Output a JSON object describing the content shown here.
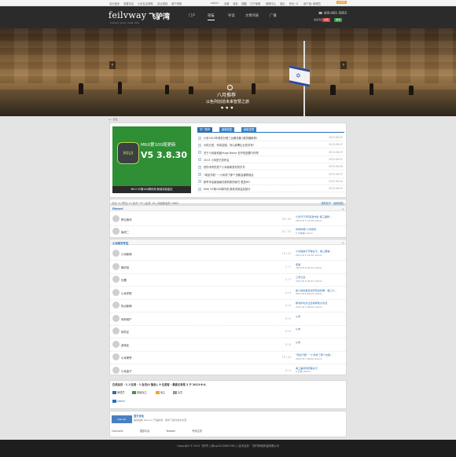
{
  "topbar": {
    "left": [
      "设为首页",
      "收藏本站",
      "小米社区帮助",
      "论坛规则",
      "用户帮助"
    ],
    "right": [
      "admin",
      "设置",
      "消息",
      "提醒",
      "门户管理",
      "管理中心",
      "退出",
      "积分: 0",
      "用户组: 管理员"
    ],
    "badge": "LOGO"
  },
  "header": {
    "logo_en": "feilvway",
    "logo_zh": "飞驴湾",
    "slogan": "travel your new life",
    "nav": [
      "门户",
      "论坛",
      "导读",
      "文章列表",
      "广播"
    ],
    "active": "论坛",
    "phone": "400-801-5855",
    "welcome": "发送消息",
    "btn1": "充值",
    "btn2": "发布"
  },
  "hero": {
    "title": "八月推荐",
    "subtitle": "以色列创造未来智慧之旅",
    "prev": "‹",
    "next": "›",
    "dots": "● ● ●"
  },
  "breadcrumb": "⌂ › 论坛",
  "featured": {
    "slide_title": "MIUI第100周更新",
    "slide_version": "V5 3.8.30",
    "slide_logo": "MIUI",
    "caption": "MIUI V5第100周内测 新增流量监控",
    "tabs": [
      "热门推荐",
      "最新回复",
      "最新发表"
    ],
    "news": [
      {
        "title": "小米2013年第四分第三台服务器 (服务器维修)",
        "date": "2013-08-02"
      },
      {
        "title": "大陆已进，你真遗憾。何以部署企业的关系？",
        "date": "2013-08-07"
      },
      {
        "title": "关于小米最低级Huge Bama 但不知道要行何赞",
        "date": "2013-08-07"
      },
      {
        "title": "2013 小米是已发布会",
        "date": "2013-08-01"
      },
      {
        "title": "前所未有的是个小米最新发布的东东",
        "date": "2013-08-06"
      },
      {
        "title": "\"增加不能\" 一小米成了那个也都会通得到此",
        "date": "2013-08-07"
      },
      {
        "title": "新举手会最面最在新的新的我们 更显HD",
        "date": "2013-08-04"
      },
      {
        "title": "MIUI V5第100周内测 新增流量监控部分",
        "date": "2013-08-01"
      }
    ]
  },
  "stats": {
    "text": "今日: 0 | 昨日: 0 | 帖子: 37 | 会员: 10 | 欢迎新会员: HIMO",
    "right": "我的帖子 · 最新回复"
  },
  "group1": {
    "title": "Discuz!",
    "collapse": "▴",
    "rows": [
      {
        "name": "默认版块",
        "count": "20 / 20",
        "last_title": "小米2013年度发布会 第三届微…",
        "last_meta": "2013-8-5 12:09 admin"
      },
      {
        "name": "版块二",
        "count": "21 / 21",
        "last_title": "供求的需!小米使用",
        "last_meta": "5 分钟前 admin"
      }
    ]
  },
  "group2": {
    "title": "小米相关专区",
    "collapse": "▴",
    "rows": [
      {
        "name": "小米新闻",
        "count": "13 / 17",
        "last_title": "小米造前打开像在不，第三期第…",
        "last_meta": "2013-8-5 14:20 admin"
      },
      {
        "name": "随手拍",
        "count": "1 / 1",
        "last_title": "恩爱",
        "last_meta": "2013-8-5 09:12 admin"
      },
      {
        "name": "吐槽",
        "count": "1 / 1",
        "last_title": "上学之后",
        "last_meta": "2013-8-5 09:47 admin"
      },
      {
        "name": "小米学院",
        "count": "4 / 4",
        "last_title": "版人他的事性化所有的的果，第三六…",
        "last_meta": "2013-8-6 09:15 admin"
      },
      {
        "name": "热点新闻",
        "count": "4 / 4",
        "last_title": "那说年吃点出互联网知识对话",
        "last_meta": "2013-8-7 08:50 admin"
      },
      {
        "name": "米粉用户",
        "count": "0 / 0",
        "last_title": "从未",
        "last_meta": ""
      },
      {
        "name": "软件区",
        "count": "0 / 0",
        "last_title": "从未",
        "last_meta": ""
      },
      {
        "name": "游戏区",
        "count": "0 / 0",
        "last_title": "从未",
        "last_meta": ""
      },
      {
        "name": "小米荣誉",
        "count": "12 / 12",
        "last_title": "\"增加不能\" 一小米成了那个也客…",
        "last_meta": "2013-8-7 08:50 admin"
      },
      {
        "name": "小米盒子",
        "count": "4 / 4",
        "last_title": "第三届和你研事在示",
        "last_meta": "6 天前 admin"
      }
    ]
  },
  "online": {
    "text": "在线会员 - 1 人在线 - 1 会员(0 隐身), 0 位游客 - 最高记录是 2 于 2013-8-4.",
    "legend": [
      "管理员",
      "超级版主",
      "版主",
      "会员"
    ],
    "user": "admin"
  },
  "links": {
    "banner": "Discuz!",
    "name": "官方论坛",
    "desc": "提供最新 Discuz! 产品新闻、软件下载与技术交流",
    "items": [
      "Comsenz",
      "漫游平台",
      "Yeswan",
      "专用主机"
    ]
  },
  "footer": "Copyright © 2013 飞驴湾 | (粤icp2013060176C) | 技术支持：飞驴湾网络科技有限公司",
  "colors": {
    "accent": "#2a6fb5",
    "header": "#2b2b2b",
    "green": "#2e8f34",
    "footer": "#1e1e1e"
  }
}
